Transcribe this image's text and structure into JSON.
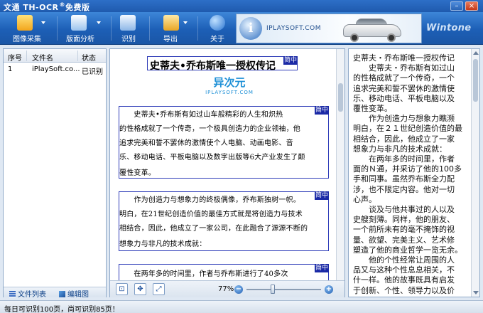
{
  "window": {
    "title": "文通 TH-OCR",
    "title_sup": "®",
    "title_suffix": "免费版",
    "min_glyph": "–",
    "close_glyph": "×"
  },
  "toolbar": {
    "buttons": [
      {
        "label": "图像采集",
        "icon": "camera-icon",
        "dropdown": true
      },
      {
        "label": "版面分析",
        "icon": "layout-icon",
        "dropdown": true
      },
      {
        "label": "识别",
        "icon": "recognize-magnifier-icon",
        "dropdown": false
      },
      {
        "label": "导出",
        "icon": "export-icon",
        "dropdown": true
      },
      {
        "label": "关于",
        "icon": "info-icon",
        "dropdown": false
      }
    ],
    "ad": {
      "glyph": "i",
      "text": "IPLAYSOFT.COM"
    },
    "logo": "Wintone"
  },
  "file_list": {
    "headers": [
      "序号",
      "文件名",
      "状态"
    ],
    "rows": [
      {
        "index": "1",
        "name": "iPlaySoft.co...",
        "status": "已识别"
      }
    ],
    "tabs": [
      "文件列表",
      "编辑图"
    ]
  },
  "image_view": {
    "title_line": "史蒂夫•乔布斯唯一授权传记",
    "tag": "简中",
    "watermark": {
      "main": "异次元",
      "sub": "IPLAYSOFT.COM"
    },
    "paragraph1": [
      "　　史蒂夫•乔布斯有如过山车般精彩的人生和炽热",
      "的性格成就了一个传奇，一个极具创造力的企业领袖，他",
      "追求完美和誓不罢休的激情使个人电脑、动画电影、音",
      "乐、移动电话、平板电脑以及数字出版等6大产业发生了颠",
      "覆性变革。"
    ],
    "paragraph2": [
      "　　作为创造力与想象力的终极偶像，乔布斯独树一帜。",
      "明白，在21世纪创造价值的最佳方式就是将创造力与技术",
      "相结合，因此，他成立了一家公司，在此融合了源源不断的",
      "想象力与非凡的技术成就："
    ],
    "paragraph3": [
      "　　在两年多的时间里，作者与乔布斯进行了40多次"
    ],
    "view_buttons": [
      "fit-icon",
      "move-icon",
      "fullscreen-icon"
    ],
    "zoom": {
      "label": "77%",
      "value": 77,
      "min": 10,
      "max": 200
    }
  },
  "result_text": {
    "lines": [
      "史蒂夫・乔布斯唯一授权传记",
      "　　史蒂夫・乔布斯有如过山",
      "的性格成就了一个传奇，一个",
      "追求完美和誓不罢休的激情使",
      "乐、移动电话、平板电脑以及",
      "覆性变革。",
      "　　作为创造力与想象力瞧濒",
      "明白，在２１世纪创造价值的最",
      "相结合，因此，他成立了一家",
      "想象力与非凡的技术成就：",
      "　　在两年多的时间里，作者",
      "面的Ｎ通，并采访了他的100多",
      "手和同事。虽然乔布斯全力配",
      "涉，也不限定内容。他对一切",
      "心声。",
      "　　谈及与他共事过的人以及",
      "史艘刻薄。同样，他的朋友、",
      "一个前所未有的毫不掩饰的视",
      "量、欲望、完美主义、艺术修",
      "塑造了他的商业哲学一览无余。",
      "　　他的个性经常让周围的人",
      "品又与这种个性息息相关，不",
      "什一样。他的故事既具有启发",
      "于创新、个性、领导力以及价"
    ]
  },
  "status": {
    "text": "每日可识别100页，尚可识别85页！"
  }
}
